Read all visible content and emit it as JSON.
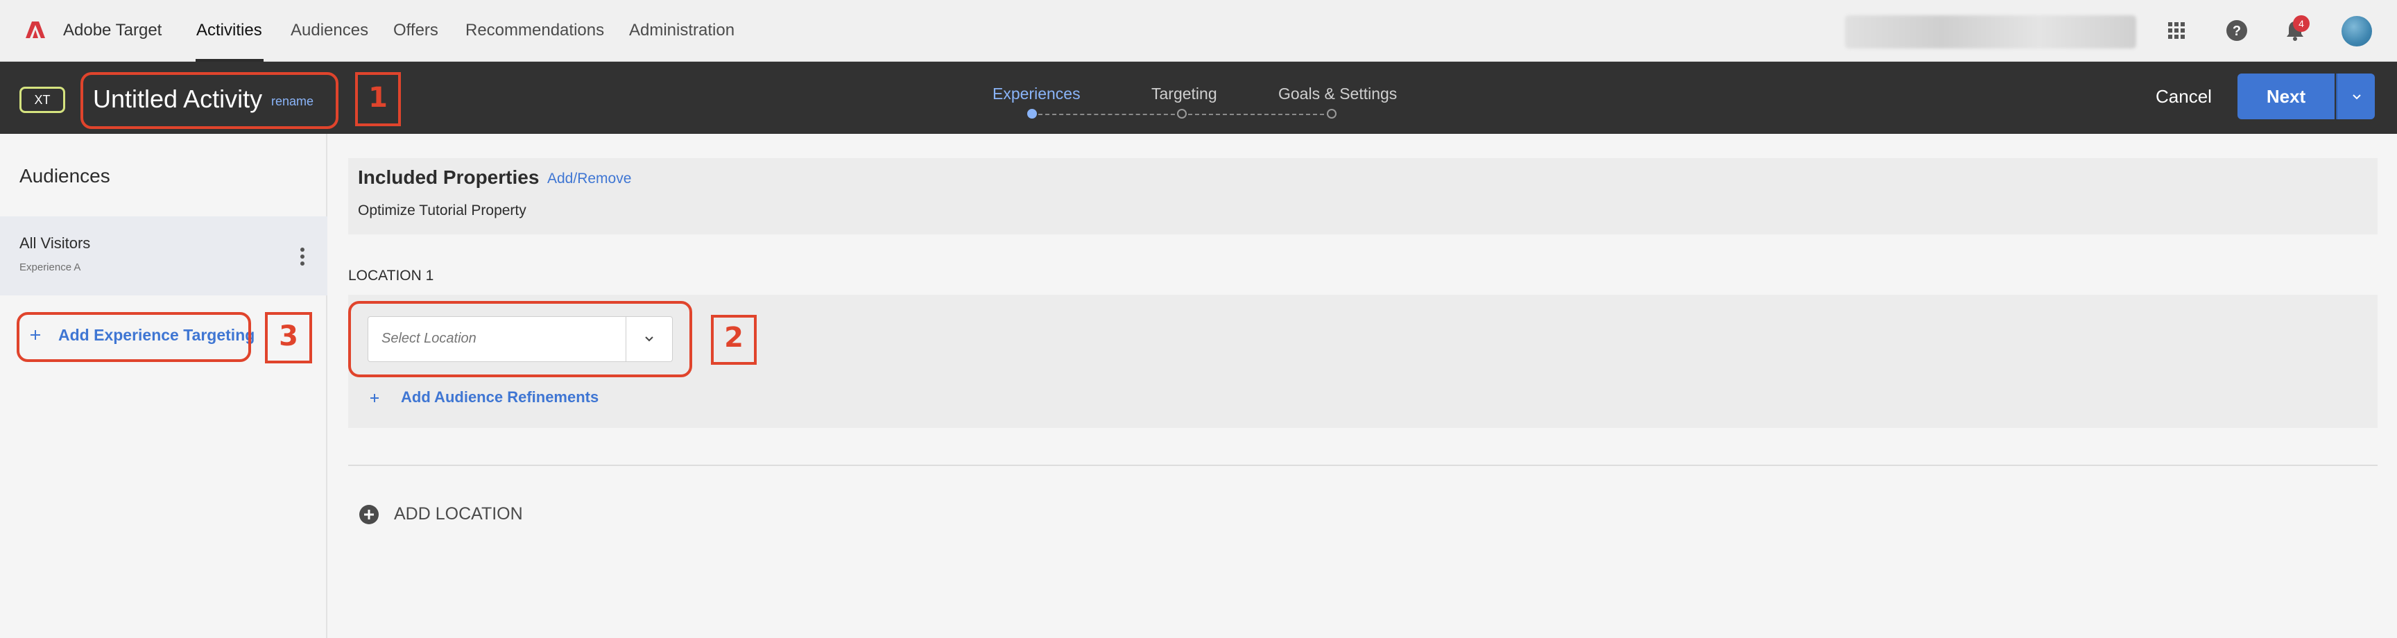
{
  "topnav": {
    "brand": "Adobe Target",
    "items": [
      {
        "label": "Activities",
        "active": true
      },
      {
        "label": "Audiences"
      },
      {
        "label": "Offers"
      },
      {
        "label": "Recommendations"
      },
      {
        "label": "Administration"
      }
    ],
    "notification_count": "4",
    "icons": [
      "apps-grid-icon",
      "help-icon",
      "bell-icon",
      "avatar"
    ]
  },
  "activity_bar": {
    "type_badge": "XT",
    "title": "Untitled Activity",
    "rename_label": "rename",
    "steps": [
      {
        "label": "Experiences",
        "active": true
      },
      {
        "label": "Targeting"
      },
      {
        "label": "Goals & Settings"
      }
    ],
    "cancel_label": "Cancel",
    "next_label": "Next"
  },
  "sidebar": {
    "title": "Audiences",
    "audiences": [
      {
        "name": "All Visitors",
        "experience": "Experience A"
      }
    ],
    "add_experience_targeting_label": "Add Experience Targeting"
  },
  "main": {
    "included_properties_title": "Included Properties",
    "add_remove_label": "Add/Remove",
    "property_value": "Optimize Tutorial Property",
    "location_label": "LOCATION 1",
    "select_location_placeholder": "Select Location",
    "add_audience_refinements_label": "Add Audience Refinements",
    "add_location_label": "ADD LOCATION"
  },
  "annotations": [
    "1",
    "2",
    "3"
  ],
  "colors": {
    "accent": "#3f76d3",
    "annotation": "#e0442c",
    "dark_bar": "#323232",
    "xt_badge_border": "#d5e37f"
  }
}
